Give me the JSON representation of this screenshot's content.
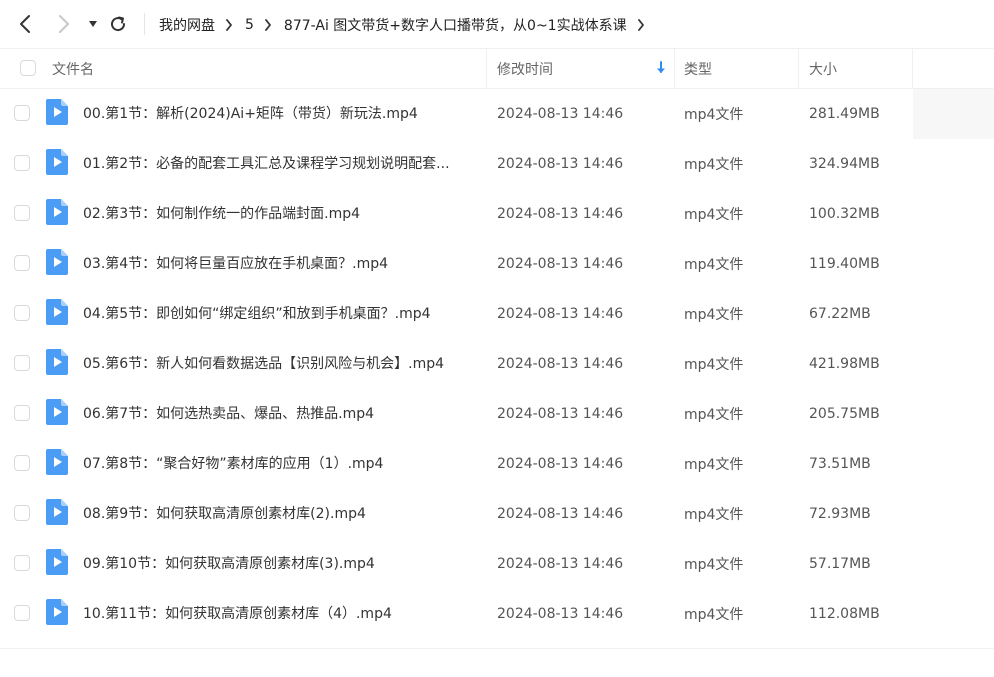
{
  "breadcrumb": [
    "我的网盘",
    "5",
    "877-Ai 图文带货+数字人口播带货，从0~1实战体系课"
  ],
  "header": {
    "name": "文件名",
    "mtime": "修改时间",
    "type": "类型",
    "size": "大小"
  },
  "files": [
    {
      "name": "00.第1节：解析(2024)Ai+矩阵（带货）新玩法.mp4",
      "mtime": "2024-08-13 14:46",
      "type": "mp4文件",
      "size": "281.49MB"
    },
    {
      "name": "01.第2节：必备的配套工具汇总及课程学习规划说明配套...",
      "mtime": "2024-08-13 14:46",
      "type": "mp4文件",
      "size": "324.94MB"
    },
    {
      "name": "02.第3节：如何制作统一的作品端封面.mp4",
      "mtime": "2024-08-13 14:46",
      "type": "mp4文件",
      "size": "100.32MB"
    },
    {
      "name": "03.第4节：如何将巨量百应放在手机桌面？.mp4",
      "mtime": "2024-08-13 14:46",
      "type": "mp4文件",
      "size": "119.40MB"
    },
    {
      "name": "04.第5节：即创如何“绑定组织”和放到手机桌面？.mp4",
      "mtime": "2024-08-13 14:46",
      "type": "mp4文件",
      "size": "67.22MB"
    },
    {
      "name": "05.第6节：新人如何看数据选品【识别风险与机会】.mp4",
      "mtime": "2024-08-13 14:46",
      "type": "mp4文件",
      "size": "421.98MB"
    },
    {
      "name": "06.第7节：如何选热卖品、爆品、热推品.mp4",
      "mtime": "2024-08-13 14:46",
      "type": "mp4文件",
      "size": "205.75MB"
    },
    {
      "name": "07.第8节：“聚合好物”素材库的应用（1）.mp4",
      "mtime": "2024-08-13 14:46",
      "type": "mp4文件",
      "size": "73.51MB"
    },
    {
      "name": "08.第9节：如何获取高清原创素材库(2).mp4",
      "mtime": "2024-08-13 14:46",
      "type": "mp4文件",
      "size": "72.93MB"
    },
    {
      "name": "09.第10节：如何获取高清原创素材库(3).mp4",
      "mtime": "2024-08-13 14:46",
      "type": "mp4文件",
      "size": "57.17MB"
    },
    {
      "name": "10.第11节：如何获取高清原创素材库（4）.mp4",
      "mtime": "2024-08-13 14:46",
      "type": "mp4文件",
      "size": "112.08MB"
    }
  ],
  "icons": {
    "back": "chevron-left-icon",
    "forward": "chevron-right-icon",
    "dropdown": "caret-down-icon",
    "refresh": "refresh-icon",
    "sort": "arrow-down-icon",
    "file": "video-file-icon"
  },
  "colors": {
    "accent": "#2f8cf2",
    "file_icon": "#4a9cf4",
    "text": "#333333",
    "muted": "#666666"
  }
}
